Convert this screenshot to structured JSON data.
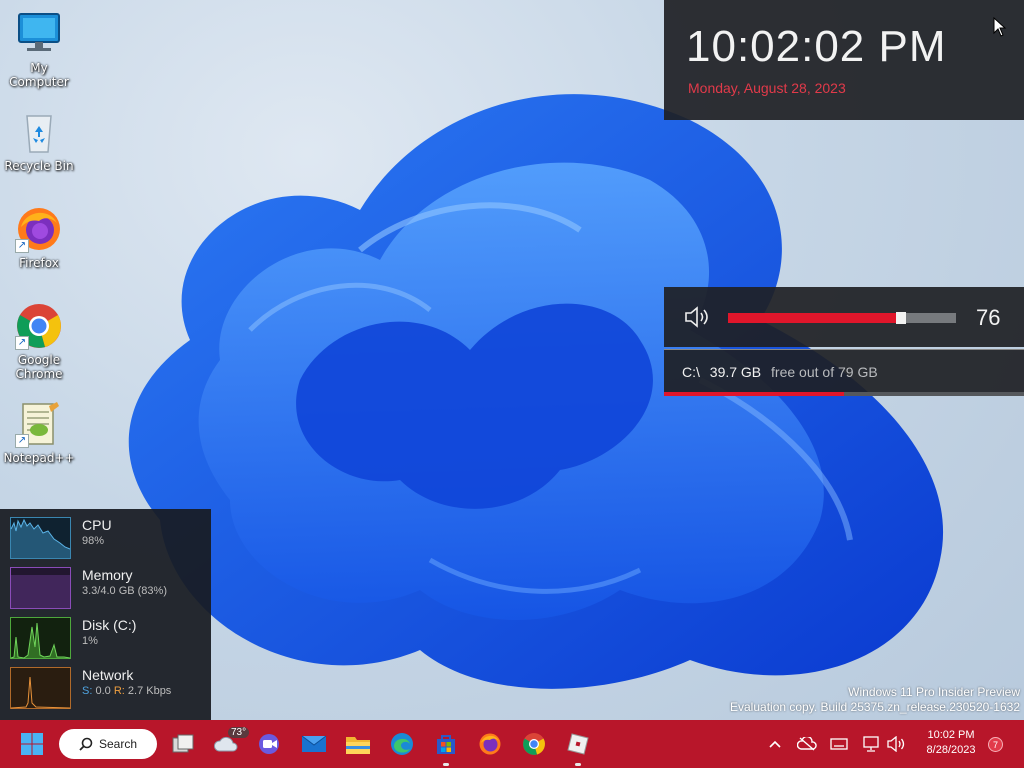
{
  "desktop": {
    "icons": [
      {
        "label": "My Computer",
        "icon": "monitor-icon"
      },
      {
        "label": "Recycle Bin",
        "icon": "recycle-bin-icon"
      },
      {
        "label": "Firefox",
        "icon": "firefox-icon"
      },
      {
        "label": "Google Chrome",
        "icon": "chrome-icon"
      },
      {
        "label": "Notepad++",
        "icon": "notepadpp-icon"
      }
    ]
  },
  "clock": {
    "time": "10:02:02 PM",
    "date": "Monday, August 28, 2023"
  },
  "volume": {
    "level": 76,
    "value_label": "76"
  },
  "drive": {
    "letter": "C:\\",
    "free": "39.7 GB",
    "suffix": "free out of 79 GB",
    "used_fraction": 0.5
  },
  "monitor": {
    "cpu": {
      "title": "CPU",
      "value": "98%"
    },
    "memory": {
      "title": "Memory",
      "value": "3.3/4.0 GB (83%)"
    },
    "disk": {
      "title": "Disk (C:)",
      "value": "1%"
    },
    "network": {
      "title": "Network",
      "s_label": "S:",
      "s_value": "0.0",
      "r_label": "R:",
      "r_value": "2.7 Kbps"
    }
  },
  "watermark": {
    "line1": "Windows 11 Pro Insider Preview",
    "line2": "Evaluation copy. Build 25375.zn_release.230520-1632"
  },
  "taskbar": {
    "search_label": "Search",
    "weather_temp": "73°",
    "tray_time": "10:02 PM",
    "tray_date": "8/28/2023",
    "notifications": "7"
  },
  "colors": {
    "accent": "#e0162b",
    "taskbar": "#b8162a",
    "widget_bg": "#1e2024"
  }
}
